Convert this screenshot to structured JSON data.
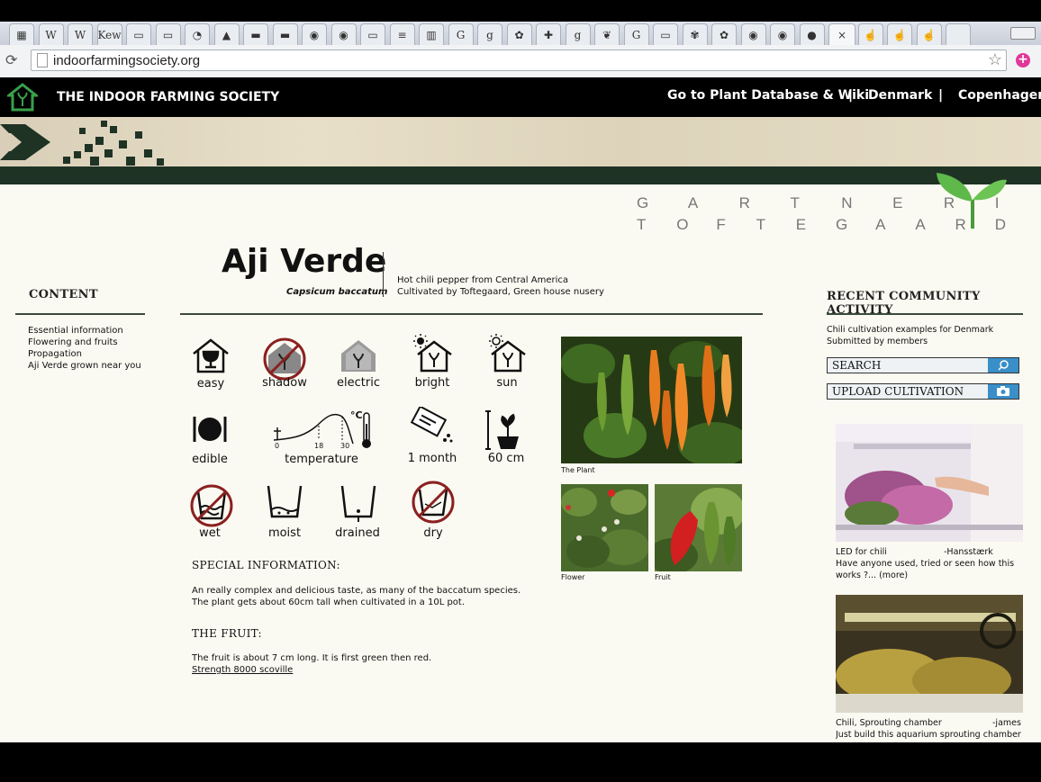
{
  "browser": {
    "url": "indoorfarmingsociety.org",
    "tabs": [
      "sheet",
      "W",
      "W",
      "Kew",
      "doc",
      "doc",
      "leaf",
      "drive",
      "slides",
      "slides",
      "map",
      "map",
      "doc",
      "docs",
      "sheets",
      "c",
      "g",
      "clover",
      "plus",
      "g",
      "chili",
      "google",
      "doc",
      "plant",
      "clover",
      "map",
      "map",
      "rec",
      "active",
      "hand",
      "hand",
      "hand",
      "new"
    ],
    "active_tab_close": "×"
  },
  "site": {
    "name": "THE INDOOR FARMING SOCIETY",
    "nav": {
      "database": "Go to Plant Database & Wiki",
      "sep1": "|",
      "country": "Denmark",
      "sep2": "|",
      "city": "Copenhagen"
    },
    "brand_line1": [
      "G",
      "A",
      "R",
      "T",
      "N",
      "E",
      "R",
      "I"
    ],
    "brand_line2": [
      "T",
      "O",
      "F",
      "T",
      "E",
      "G",
      "A",
      "A",
      "R",
      "D"
    ]
  },
  "content_sidebar": {
    "heading": "CONTENT",
    "links": [
      "Essential information",
      "Flowering and fruits",
      "Propagation",
      "Aji Verde grown near you"
    ]
  },
  "plant": {
    "name": "Aji Verde",
    "latin": "Capsicum baccatum",
    "desc1": "Hot chili pepper from Central America",
    "desc2": "Cultivated by Toftegaard, Green house nusery",
    "icons_row1": [
      "easy",
      "shadow",
      "electric",
      "bright",
      "sun"
    ],
    "icons_row2": [
      "edible",
      "temperature",
      "1 month",
      "60 cm"
    ],
    "temp_ticks": [
      "0",
      "18",
      "30"
    ],
    "temp_unit": "°C",
    "icons_row3": [
      "wet",
      "moist",
      "drained",
      "dry"
    ],
    "special_heading": "SPECIAL INFORMATION:",
    "special_text1": "An really complex and delicious taste, as many of the baccatum species.",
    "special_text2": "The plant gets about 60cm tall when cultivated in a 10L pot.",
    "fruit_heading": "THE FRUIT:",
    "fruit_text": "The fruit is about 7 cm long. It is first green then red.",
    "fruit_link": "Strength 8000 scoville",
    "photo_captions": {
      "plant": "The Plant",
      "flower": "Flower",
      "fruit": "Fruit"
    }
  },
  "activity": {
    "heading": "RECENT COMMUNITY ACTIVITY",
    "intro1": "Chili cultivation examples for Denmark",
    "intro2": "Submitted by members",
    "search_label": "SEARCH",
    "upload_label": "UPLOAD CULTIVATION",
    "posts": [
      {
        "title": "LED for chili",
        "author": "-Hansstærk",
        "text1": "Have anyone used, tried or seen how this",
        "text2": "works ?... (more)"
      },
      {
        "title": "Chili, Sprouting chamber",
        "author": "-james",
        "text1": "Just build this aquarium sprouting chamber in",
        "text2": ""
      }
    ]
  },
  "colors": {
    "dark_green": "#1f3325",
    "accent_blue": "#3a8fc8",
    "no_red": "#8b2020",
    "page_bg": "#fbfaf2"
  }
}
